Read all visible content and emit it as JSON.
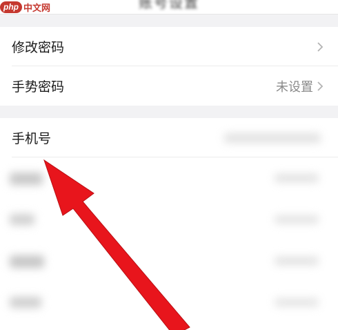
{
  "header": {
    "title": "账号设置",
    "watermark_logo": "php",
    "watermark_text": "中文网"
  },
  "security": {
    "change_password_label": "修改密码",
    "gesture_password_label": "手势密码",
    "gesture_password_value": "未设置"
  },
  "account": {
    "phone_label": "手机号"
  },
  "icons": {
    "chevron": "chevron-right-icon",
    "arrow": "red-arrow-annotation"
  },
  "colors": {
    "background": "#f2f2f4",
    "arrow_red": "#e8151c",
    "watermark_red": "#c5382f"
  }
}
